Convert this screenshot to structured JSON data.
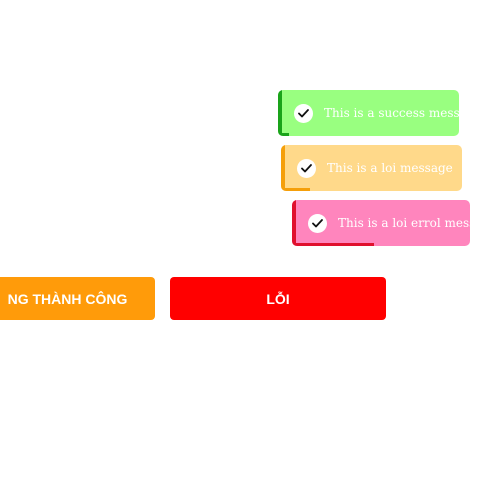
{
  "toasts": [
    {
      "id": "success",
      "message": "This is a success message",
      "icon": "check-icon",
      "background": "#99ff80",
      "accent": "#1aa31a",
      "progress": 0.06
    },
    {
      "id": "warning",
      "message": "This is a loi message",
      "icon": "check-icon",
      "background": "#ffd98a",
      "accent": "#f59f0a",
      "progress": 0.16
    },
    {
      "id": "error",
      "message": "This is a loi errol message",
      "icon": "check-icon",
      "background": "#ff85bd",
      "accent": "#e0102e",
      "progress": 0.46
    }
  ],
  "buttons": {
    "success_label": "NG THÀNH CÔNG",
    "success_color": "#ff9b0a",
    "error_label": "LỖI",
    "error_color": "#ff0000"
  }
}
